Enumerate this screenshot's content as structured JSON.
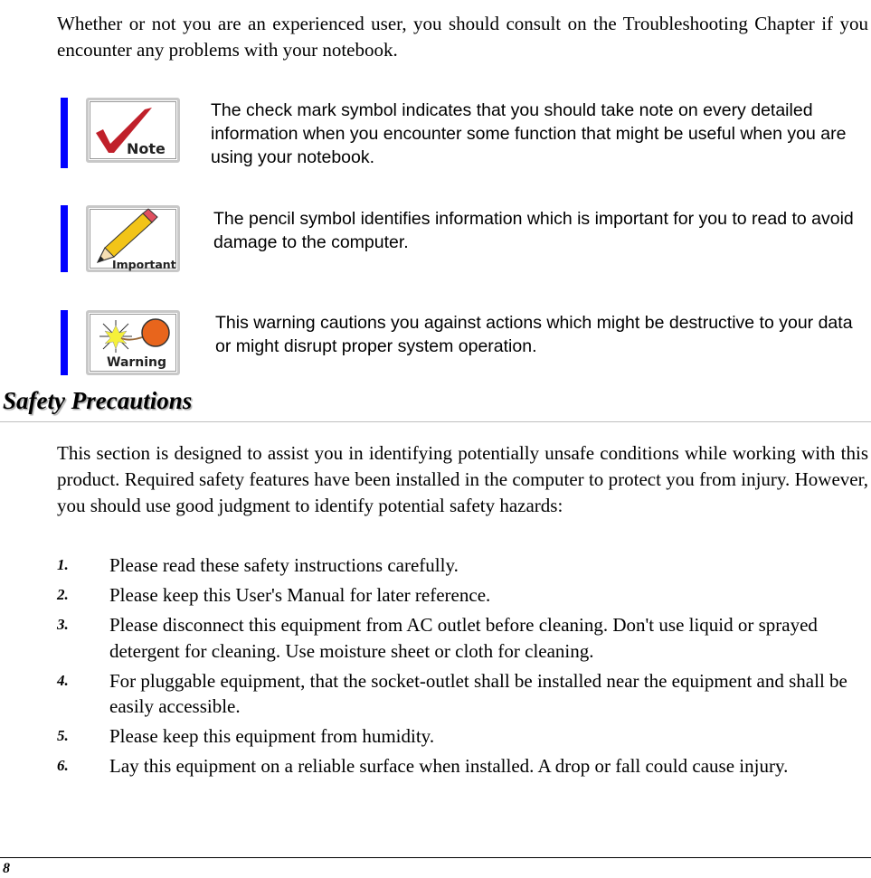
{
  "intro": "Whether or not you are an experienced user, you should consult on the Troubleshooting Chapter if you encounter any problems with your notebook.",
  "notices": [
    {
      "icon": "check-mark-note-icon",
      "icon_label": "Note",
      "text": "The check mark symbol indicates that you should take note on every detailed information when you encounter some function that might be useful when you are using your notebook."
    },
    {
      "icon": "pencil-important-icon",
      "icon_label": "Important",
      "text": "The pencil symbol identifies information which is important for you to read to avoid damage to the computer."
    },
    {
      "icon": "bomb-warning-icon",
      "icon_label": "Warning",
      "text": "This warning cautions you against actions which might be destructive to your data or might disrupt proper system operation."
    }
  ],
  "section": {
    "title": "Safety Precautions",
    "paragraph": "This section is designed to assist you in identifying potentially unsafe conditions while working with this product.  Required safety features have been installed in the computer to protect you from injury.  However, you should use good judgment to identify potential safety hazards:",
    "items": [
      {
        "num": "1.",
        "text": "Please read these safety instructions carefully."
      },
      {
        "num": "2.",
        "text": "Please keep this User's Manual for later reference."
      },
      {
        "num": "3.",
        "text": "Please disconnect this equipment from AC outlet before cleaning.  Don't use liquid or sprayed detergent for cleaning.  Use moisture sheet or cloth for cleaning."
      },
      {
        "num": "4.",
        "text": "For pluggable equipment, that the socket-outlet shall be installed near the equipment and shall be easily accessible."
      },
      {
        "num": "5.",
        "text": "Please keep this equipment from humidity."
      },
      {
        "num": "6.",
        "text": "Lay this equipment on a reliable surface when installed.  A drop or fall could cause injury."
      }
    ]
  },
  "colors": {
    "accent_bar": "#0000ff",
    "check": "#c0202a",
    "pencil": "#f2c418",
    "bomb": "#e8651c"
  },
  "footer": {
    "page_number": "8"
  }
}
